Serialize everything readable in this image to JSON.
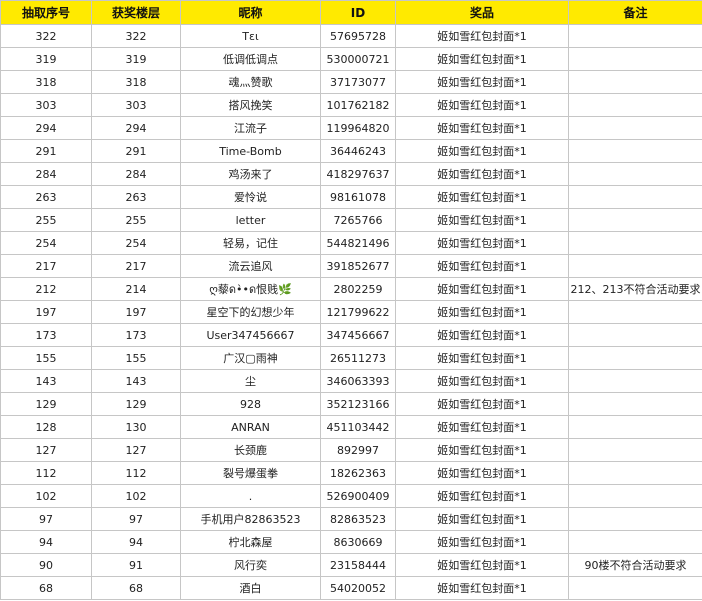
{
  "headers": [
    "抽取序号",
    "获奖楼层",
    "昵称",
    "ID",
    "奖品",
    "备注"
  ],
  "rows": [
    {
      "draw_no": "322",
      "floor": "322",
      "nickname": "Tει",
      "id": "57695728",
      "prize": "姬如雪红包封面*1",
      "note": ""
    },
    {
      "draw_no": "319",
      "floor": "319",
      "nickname": "低调低调点",
      "id": "530000721",
      "prize": "姬如雪红包封面*1",
      "note": ""
    },
    {
      "draw_no": "318",
      "floor": "318",
      "nickname": "魂灬赞歌",
      "id": "37173077",
      "prize": "姬如雪红包封面*1",
      "note": ""
    },
    {
      "draw_no": "303",
      "floor": "303",
      "nickname": "搭风挽笑",
      "id": "101762182",
      "prize": "姬如雪红包封面*1",
      "note": ""
    },
    {
      "draw_no": "294",
      "floor": "294",
      "nickname": "江流子",
      "id": "119964820",
      "prize": "姬如雪红包封面*1",
      "note": ""
    },
    {
      "draw_no": "291",
      "floor": "291",
      "nickname": "Time-Bomb",
      "id": "36446243",
      "prize": "姬如雪红包封面*1",
      "note": ""
    },
    {
      "draw_no": "284",
      "floor": "284",
      "nickname": "鸡汤来了",
      "id": "418297637",
      "prize": "姬如雪红包封面*1",
      "note": ""
    },
    {
      "draw_no": "263",
      "floor": "263",
      "nickname": "爱怜说",
      "id": "98161078",
      "prize": "姬如雪红包封面*1",
      "note": ""
    },
    {
      "draw_no": "255",
      "floor": "255",
      "nickname": "letter",
      "id": "7265766",
      "prize": "姬如雪红包封面*1",
      "note": ""
    },
    {
      "draw_no": "254",
      "floor": "254",
      "nickname": "轻易，记住",
      "id": "544821496",
      "prize": "姬如雪红包封面*1",
      "note": ""
    },
    {
      "draw_no": "217",
      "floor": "217",
      "nickname": "流云追风",
      "id": "391852677",
      "prize": "姬如雪红包封面*1",
      "note": ""
    },
    {
      "draw_no": "212",
      "floor": "214",
      "nickname": "ღ藜ด•̀•ด恨贱🌿",
      "id": "2802259",
      "prize": "姬如雪红包封面*1",
      "note": "212、213不符合活动要求"
    },
    {
      "draw_no": "197",
      "floor": "197",
      "nickname": "星空下的幻想少年",
      "id": "121799622",
      "prize": "姬如雪红包封面*1",
      "note": ""
    },
    {
      "draw_no": "173",
      "floor": "173",
      "nickname": "User347456667",
      "id": "347456667",
      "prize": "姬如雪红包封面*1",
      "note": ""
    },
    {
      "draw_no": "155",
      "floor": "155",
      "nickname": "广汉▢雨神",
      "id": "26511273",
      "prize": "姬如雪红包封面*1",
      "note": ""
    },
    {
      "draw_no": "143",
      "floor": "143",
      "nickname": "尘",
      "id": "346063393",
      "prize": "姬如雪红包封面*1",
      "note": ""
    },
    {
      "draw_no": "129",
      "floor": "129",
      "nickname": "928",
      "id": "352123166",
      "prize": "姬如雪红包封面*1",
      "note": ""
    },
    {
      "draw_no": "128",
      "floor": "130",
      "nickname": "ANRAN",
      "id": "451103442",
      "prize": "姬如雪红包封面*1",
      "note": ""
    },
    {
      "draw_no": "127",
      "floor": "127",
      "nickname": "长颈鹿",
      "id": "892997",
      "prize": "姬如雪红包封面*1",
      "note": ""
    },
    {
      "draw_no": "112",
      "floor": "112",
      "nickname": "裂号爆蛋拳",
      "id": "18262363",
      "prize": "姬如雪红包封面*1",
      "note": ""
    },
    {
      "draw_no": "102",
      "floor": "102",
      "nickname": ".",
      "id": "526900409",
      "prize": "姬如雪红包封面*1",
      "note": ""
    },
    {
      "draw_no": "97",
      "floor": "97",
      "nickname": "手机用户82863523",
      "id": "82863523",
      "prize": "姬如雪红包封面*1",
      "note": ""
    },
    {
      "draw_no": "94",
      "floor": "94",
      "nickname": "柠北森屋",
      "id": "8630669",
      "prize": "姬如雪红包封面*1",
      "note": ""
    },
    {
      "draw_no": "90",
      "floor": "91",
      "nickname": "风行奕",
      "id": "23158444",
      "prize": "姬如雪红包封面*1",
      "note": "90楼不符合活动要求"
    },
    {
      "draw_no": "68",
      "floor": "68",
      "nickname": "酒白",
      "id": "54020052",
      "prize": "姬如雪红包封面*1",
      "note": ""
    }
  ]
}
